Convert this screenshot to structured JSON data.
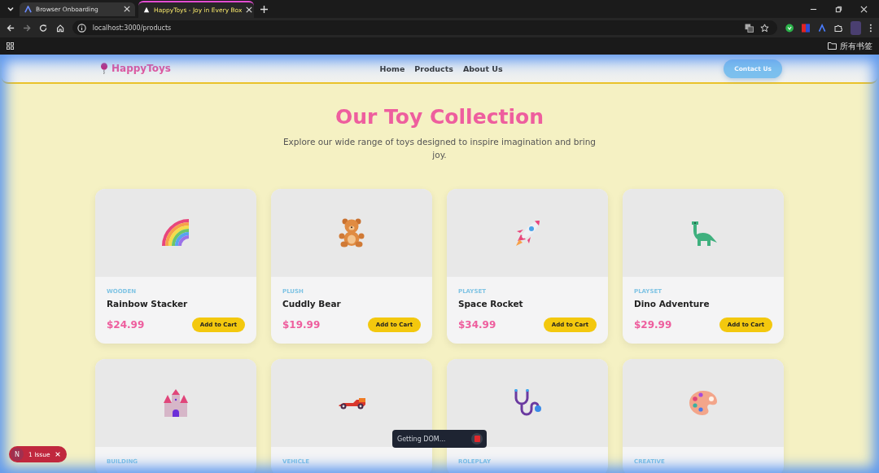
{
  "browser": {
    "tabs": [
      {
        "title": "Browser Onboarding",
        "selected": false
      },
      {
        "title": "HappyToys - Joy in Every Box",
        "selected": true
      }
    ],
    "url": "localhost:3000/products",
    "bookmarks_label": "所有书签"
  },
  "nav": {
    "brand": "HappyToys",
    "links": [
      "Home",
      "Products",
      "About Us"
    ],
    "cta": "Contact Us"
  },
  "hero": {
    "title": "Our Toy Collection",
    "subtitle": "Explore our wide range of toys designed to inspire imagination and bring joy."
  },
  "products": [
    {
      "category": "WOODEN",
      "name": "Rainbow Stacker",
      "price": "$24.99",
      "button": "Add to Cart"
    },
    {
      "category": "PLUSH",
      "name": "Cuddly Bear",
      "price": "$19.99",
      "button": "Add to Cart"
    },
    {
      "category": "PLAYSET",
      "name": "Space Rocket",
      "price": "$34.99",
      "button": "Add to Cart"
    },
    {
      "category": "PLAYSET",
      "name": "Dino Adventure",
      "price": "$29.99",
      "button": "Add to Cart"
    },
    {
      "category": "BUILDING"
    },
    {
      "category": "VEHICLE"
    },
    {
      "category": "ROLEPLAY"
    },
    {
      "category": "CREATIVE"
    }
  ],
  "dev": {
    "avatar": "N",
    "issues": "1 Issue",
    "status": "Getting DOM..."
  }
}
